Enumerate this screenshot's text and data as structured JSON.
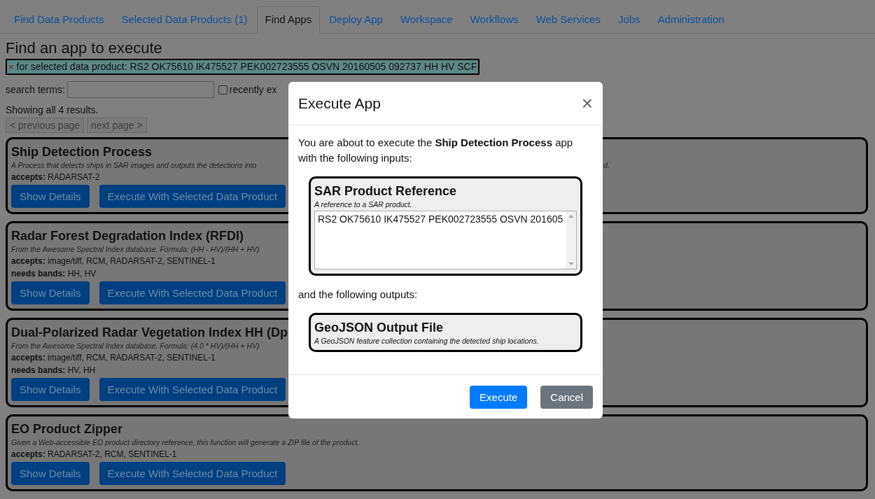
{
  "tabs": [
    {
      "label": "Find Data Products",
      "selected": false
    },
    {
      "label": "Selected Data Products (1)",
      "selected": false
    },
    {
      "label": "Find Apps",
      "selected": true
    },
    {
      "label": "Deploy App",
      "selected": false
    },
    {
      "label": "Workspace",
      "selected": false
    },
    {
      "label": "Workflows",
      "selected": false
    },
    {
      "label": "Web Services",
      "selected": false
    },
    {
      "label": "Jobs",
      "selected": false
    },
    {
      "label": "Administration",
      "selected": false
    }
  ],
  "heading": "Find an app to execute",
  "filter_banner": {
    "remove": "×",
    "text": "for selected data product: RS2 OK75610 IK475527 PEK002723555 OSVN 20160505 092737 HH HV SCF"
  },
  "search": {
    "label": "search terms:"
  },
  "recent_filter": {
    "label": "recently ex",
    "checked": false
  },
  "results_summary": "Showing all 4 results.",
  "pager": [
    {
      "label": "< previous page",
      "disabled": true
    },
    {
      "label": "next page >",
      "disabled": true
    }
  ],
  "apps": [
    {
      "title": "Ship Detection Process",
      "description": "A Process that detects ships in SAR images and outputs the detections into",
      "description_end": "d.",
      "accepts": "**accepts:** RADARSAT-2",
      "buttons": [
        "Show Details",
        "Execute With Selected Data Product"
      ]
    },
    {
      "title": "Radar Forest Degradation Index (RFDI)",
      "description": "From the Awesome Spectral Index database. Formula: (HH - HV)/(HH + HV)",
      "accepts": "**accepts:** image/tiff, RCM, RADARSAT-2, SENTINEL-1",
      "needs_bands": "**needs bands:** HH, HV",
      "buttons": [
        "Show Details",
        "Execute With Selected Data Product"
      ]
    },
    {
      "title": "Dual-Polarized Radar Vegetation Index HH (Dp",
      "description": "From the Awesome Spectral Index database. Formula: (4.0 * HV)/(HH + HV)",
      "accepts": "**accepts:** image/tiff, RCM, RADARSAT-2, SENTINEL-1",
      "needs_bands": "**needs bands:** HV, HH",
      "buttons": [
        "Show Details",
        "Execute With Selected Data Product"
      ]
    },
    {
      "title": "EO Product Zipper",
      "description": "Given a Web-accessible EO product directory reference, this function will generate a ZIP file of the product.",
      "accepts": "**accepts:** RADARSAT-2, RCM, SENTINEL-1",
      "buttons": [
        "Show Details",
        "Execute With Selected Data Product"
      ]
    }
  ],
  "modal": {
    "title": "Execute App",
    "close": "×",
    "intro": "You are about to execute the **Ship Detection Process** app with the following inputs:",
    "inputs": [
      {
        "title": "SAR Product Reference",
        "description": "A reference to a SAR product.",
        "value": "RS2 OK75610 IK475527 PEK002723555 OSVN 201605"
      }
    ],
    "outputs_intro": "and the following outputs:",
    "outputs": [
      {
        "title": "GeoJSON Output File",
        "description": "A GeoJSON feature collection containing the detected ship locations."
      }
    ],
    "buttons": [
      {
        "label": "Execute",
        "kind": "primary"
      },
      {
        "label": "Cancel",
        "kind": "secondary"
      }
    ]
  }
}
